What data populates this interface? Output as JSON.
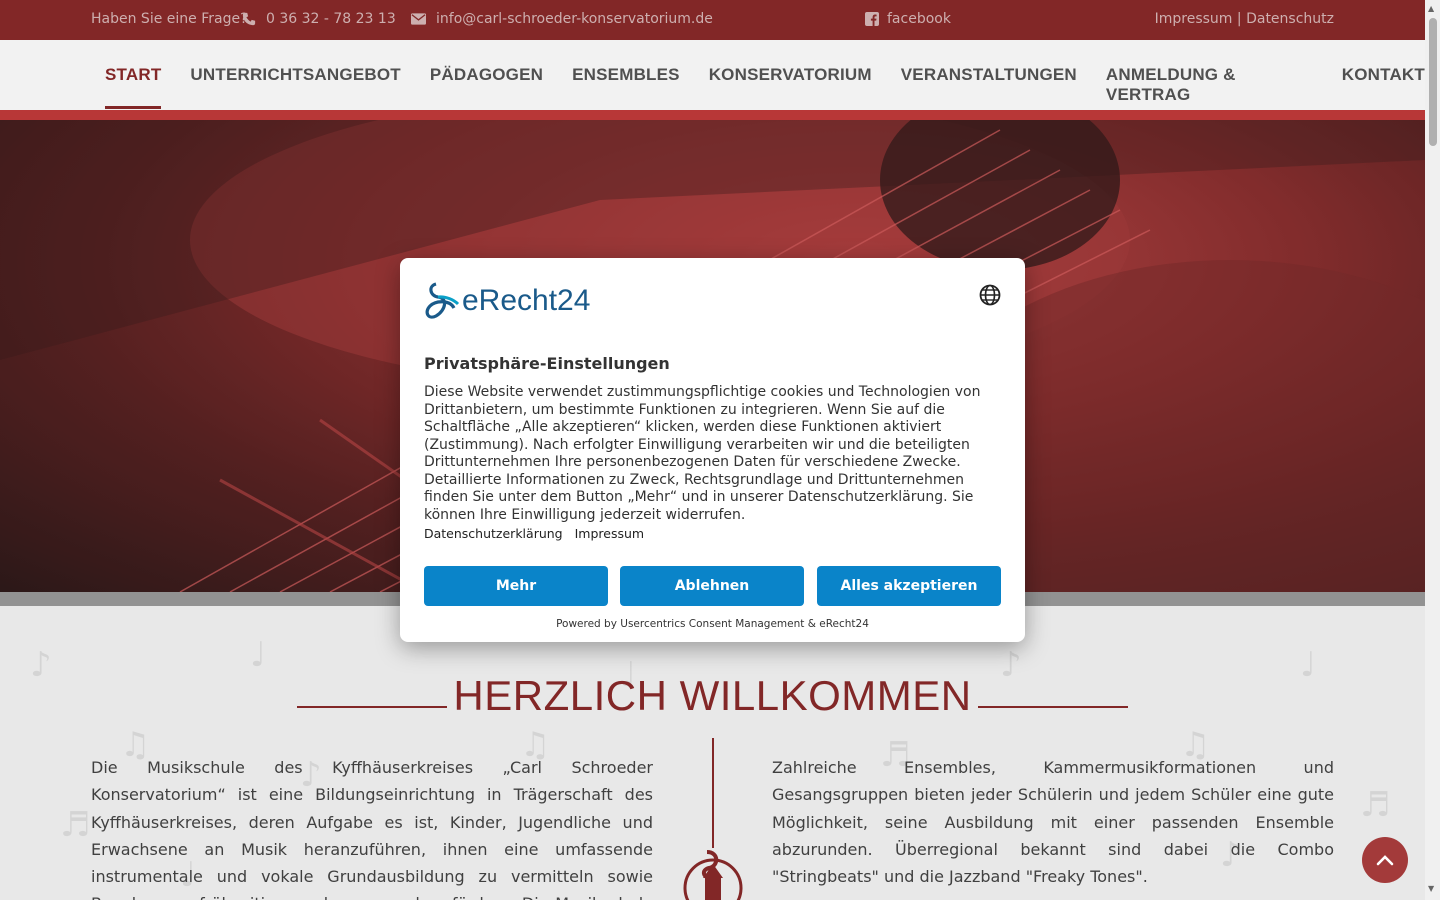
{
  "topbar": {
    "question": "Haben Sie eine Frage?",
    "phone": "0 36 32 - 78 23 13",
    "email": "info@carl-schroeder-konservatorium.de",
    "facebook": "facebook",
    "impressum": "Impressum",
    "separator": "|",
    "datenschutz": "Datenschutz",
    "bg_color": "#8a2a2a"
  },
  "nav": {
    "items": [
      {
        "label": "START",
        "active": true
      },
      {
        "label": "UNTERRICHTSANGEBOT"
      },
      {
        "label": "PÄDAGOGEN"
      },
      {
        "label": "ENSEMBLES"
      },
      {
        "label": "KONSERVATORIUM"
      },
      {
        "label": "VERANSTALTUNGEN"
      },
      {
        "label": "ANMELDUNG & VERTRAG"
      },
      {
        "label": "KONTAKT"
      }
    ],
    "accent": "#c23a3a"
  },
  "main": {
    "heading": "HERZLICH WILLKOMMEN",
    "left_text": "Die Musikschule des Kyffhäuserkreises „Carl Schroeder Konservatorium“ ist eine Bildungseinrichtung in Trägerschaft des Kyffhäuserkreises, deren Aufgabe es ist, Kinder, Jugendliche und Erwachsene an Musik heranzuführen, ihnen eine umfassende instrumentale und vokale Grundausbildung zu vermitteln sowie Begabungen frühzeitig zu erkennen und zu fördern. Die Musikschule bildet so den Nachwuchs für Laienmusizierende",
    "right_text": "Zahlreiche Ensembles, Kammermusikformationen und Gesangsgruppen bieten jeder Schülerin und jedem Schüler eine gute Möglichkeit, seine Ausbildung mit einer passenden Ensemble abzurunden. Überregional bekannt sind dabei die Combo \"Stringbeats\" und die Jazzband \"Freaky Tones\"."
  },
  "consent": {
    "logo_text": "eRecht24",
    "title": "Privatsphäre-Einstellungen",
    "body": "Diese Website verwendet zustimmungspflichtige cookies und Technologien von Drittanbietern, um bestimmte Funktionen zu integrieren. Wenn Sie auf die Schaltfläche „Alle akzeptieren“ klicken, werden diese Funktionen aktiviert (Zustimmung). Nach erfolgter Einwilligung verarbeiten wir und die beteiligten Drittunternehmen Ihre personenbezogenen Daten für verschiedene Zwecke. Detaillierte Informationen zu Zweck, Rechtsgrundlage und Drittunternehmen finden Sie unter dem Button „Mehr“ und in unserer Datenschutzerklärung. Sie können Ihre Einwilligung jederzeit widerrufen.",
    "link_privacy": "Datenschutzerklärung",
    "link_imprint": "Impressum",
    "btn_more": "Mehr",
    "btn_deny": "Ablehnen",
    "btn_accept": "Alles akzeptieren",
    "powered": "Powered by Usercentrics Consent Management & eRecht24",
    "button_color": "#0a84c9"
  },
  "icons": {
    "phone": "phone-icon",
    "mail": "envelope-icon",
    "facebook": "facebook-icon",
    "globe": "globe-icon",
    "to_top": "chevron-up-icon"
  }
}
